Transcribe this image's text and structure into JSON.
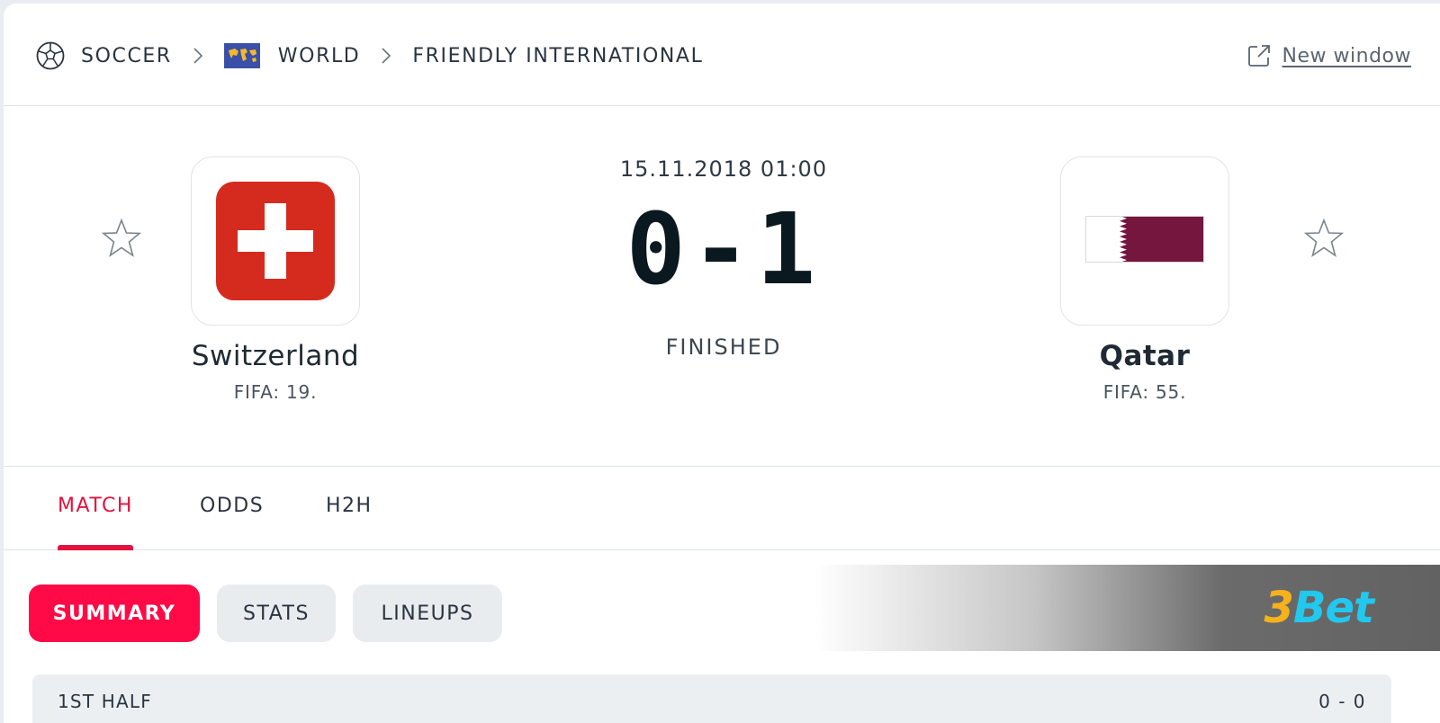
{
  "breadcrumb": {
    "sport": "SOCCER",
    "region": "WORLD",
    "competition": "FRIENDLY INTERNATIONAL",
    "new_window": "New window"
  },
  "match": {
    "datetime": "15.11.2018 01:00",
    "score": "0-1",
    "status": "FINISHED",
    "home": {
      "name": "Switzerland",
      "rank": "FIFA: 19."
    },
    "away": {
      "name": "Qatar",
      "rank": "FIFA: 55."
    }
  },
  "tabs": [
    {
      "label": "MATCH",
      "active": true
    },
    {
      "label": "ODDS",
      "active": false
    },
    {
      "label": "H2H",
      "active": false
    }
  ],
  "subtabs": [
    {
      "label": "SUMMARY",
      "active": true
    },
    {
      "label": "STATS",
      "active": false
    },
    {
      "label": "LINEUPS",
      "active": false
    }
  ],
  "ad": {
    "brand_number": "3",
    "brand_word": "Bet"
  },
  "periods": [
    {
      "label": "1ST HALF",
      "score": "0 - 0"
    }
  ],
  "colors": {
    "accent": "#e3133f",
    "pill_active": "#ff0a46",
    "swiss_red": "#d52b1e",
    "qatar_maroon": "#75163f"
  }
}
